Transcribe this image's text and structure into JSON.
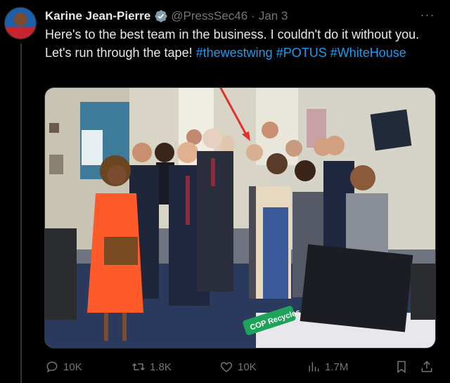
{
  "tweet": {
    "author_name": "Karine Jean-Pierre",
    "handle": "@PressSec46",
    "separator": "·",
    "date": "Jan 3",
    "more_label": "···",
    "text_main": "Here's to the best team in the business. I couldn't do it without you. Let's run through the tape!",
    "hashtags": [
      "#thewestwing",
      "#POTUS",
      "#WhiteHouse"
    ]
  },
  "photo": {
    "sign_text": "COP Recycles"
  },
  "actions": {
    "replies": "10K",
    "retweets": "1.8K",
    "likes": "10K",
    "views": "1.7M"
  },
  "icons": {
    "verified": "verified-badge-icon",
    "reply": "reply-icon",
    "retweet": "retweet-icon",
    "like": "heart-icon",
    "views": "views-icon",
    "bookmark": "bookmark-icon",
    "share": "share-icon"
  },
  "colors": {
    "background": "#000000",
    "text": "#e7e9ea",
    "muted": "#71767b",
    "link": "#1d9bf0"
  }
}
